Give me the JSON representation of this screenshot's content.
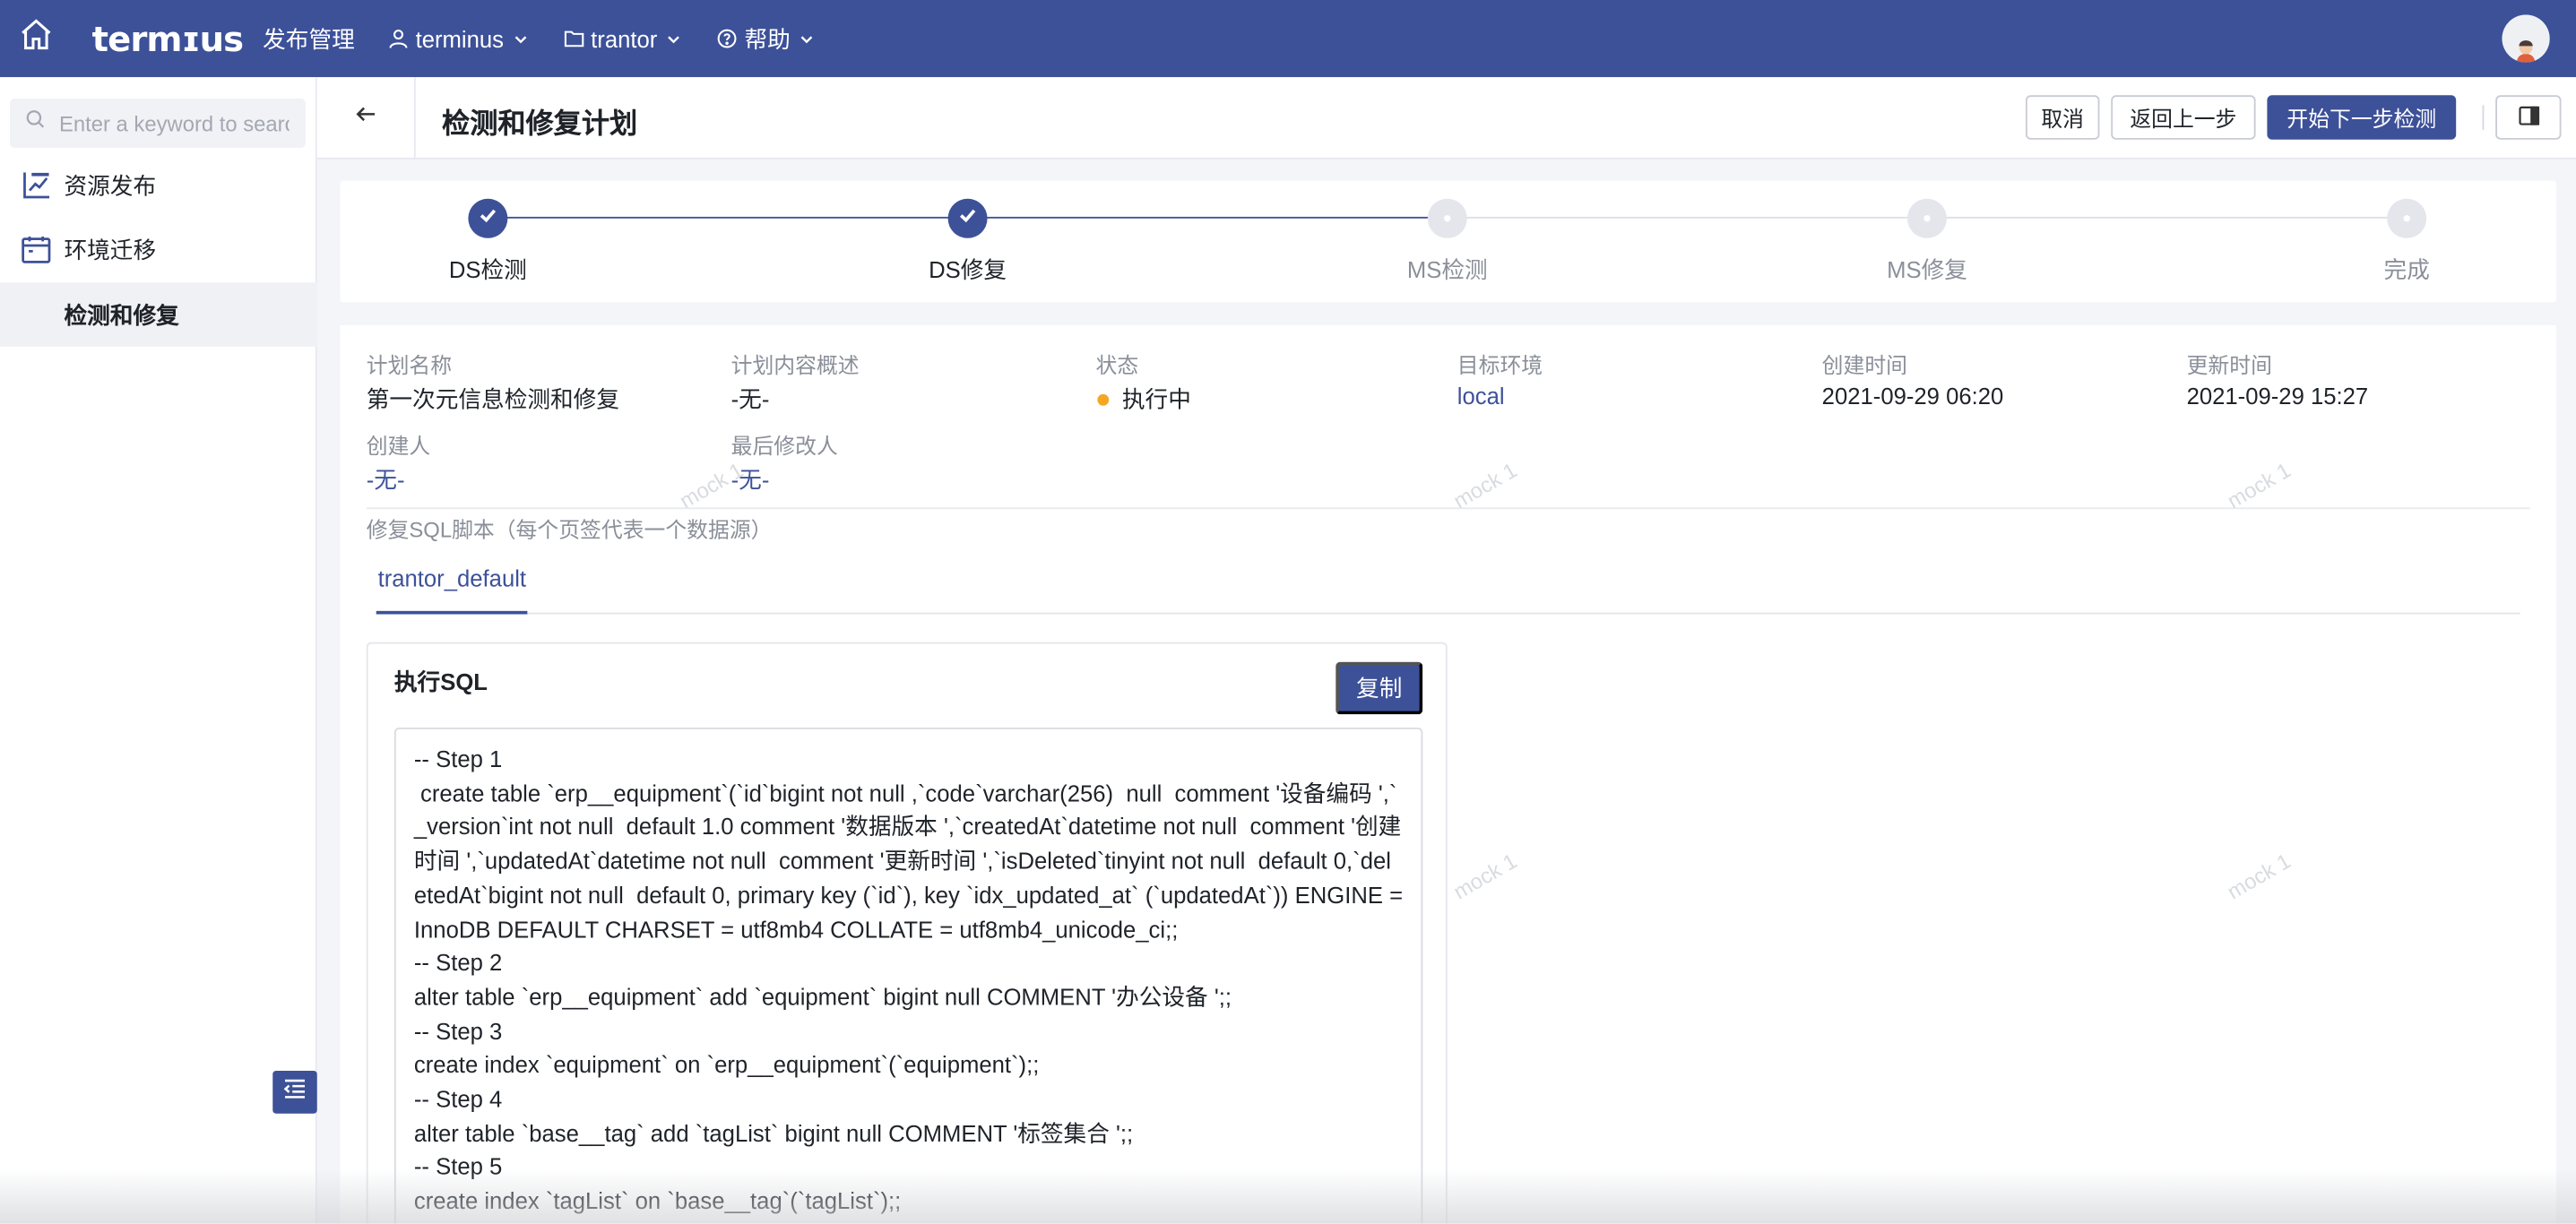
{
  "topbar": {
    "logo": "termɪus",
    "product": "发布管理",
    "menus": [
      {
        "label": "terminus",
        "icon": "user-icon"
      },
      {
        "label": "trantor",
        "icon": "folder-icon"
      },
      {
        "label": "帮助",
        "icon": "help-circle-icon"
      }
    ]
  },
  "sidebar": {
    "search_placeholder": "Enter a keyword to search",
    "items": [
      {
        "label": "资源发布",
        "icon": "chart-icon"
      },
      {
        "label": "环境迁移",
        "icon": "calendar-icon"
      },
      {
        "label": "检测和修复",
        "active": true
      }
    ]
  },
  "header": {
    "title": "检测和修复计划",
    "buttons": {
      "cancel": "取消",
      "prev": "返回上一步",
      "next": "开始下一步检测"
    }
  },
  "steps": [
    {
      "label": "DS检测",
      "status": "done"
    },
    {
      "label": "DS修复",
      "status": "done"
    },
    {
      "label": "MS检测",
      "status": "pending"
    },
    {
      "label": "MS修复",
      "status": "pending"
    },
    {
      "label": "完成",
      "status": "pending"
    }
  ],
  "info": {
    "plan_name": {
      "label": "计划名称",
      "value": "第一次元信息检测和修复"
    },
    "summary": {
      "label": "计划内容概述",
      "value": "-无-"
    },
    "status": {
      "label": "状态",
      "value": "执行中",
      "color": "#f5a623"
    },
    "target_env": {
      "label": "目标环境",
      "value": "local"
    },
    "created": {
      "label": "创建时间",
      "value": "2021-09-29 06:20"
    },
    "updated": {
      "label": "更新时间",
      "value": "2021-09-29 15:27"
    },
    "creator": {
      "label": "创建人",
      "value": "-无-"
    },
    "modifier": {
      "label": "最后修改人",
      "value": "-无-"
    }
  },
  "sql_section": {
    "title": "修复SQL脚本（每个页签代表一个数据源）",
    "tabs": [
      "trantor_default"
    ],
    "card_title": "执行SQL",
    "copy_label": "复制",
    "content": "-- Step 1\n create table `erp__equipment`(`id`bigint not null ,`code`varchar(256)  null  comment '设备编码 ',`_version`int not null  default 1.0 comment '数据版本 ',`createdAt`datetime not null  comment '创建时间 ',`updatedAt`datetime not null  comment '更新时间 ',`isDeleted`tinyint not null  default 0,`deletedAt`bigint not null  default 0, primary key (`id`), key `idx_updated_at` (`updatedAt`)) ENGINE = InnoDB DEFAULT CHARSET = utf8mb4 COLLATE = utf8mb4_unicode_ci;;\n-- Step 2\nalter table `erp__equipment` add `equipment` bigint null COMMENT '办公设备 ';;\n-- Step 3\ncreate index `equipment` on `erp__equipment`(`equipment`);;\n-- Step 4\nalter table `base__tag` add `tagList` bigint null COMMENT '标签集合 ';;\n-- Step 5\ncreate index `tagList` on `base__tag`(`tagList`);;"
  },
  "watermark": "mock 1",
  "colors": {
    "primary": "#3d5199",
    "status_running": "#f5a623"
  }
}
